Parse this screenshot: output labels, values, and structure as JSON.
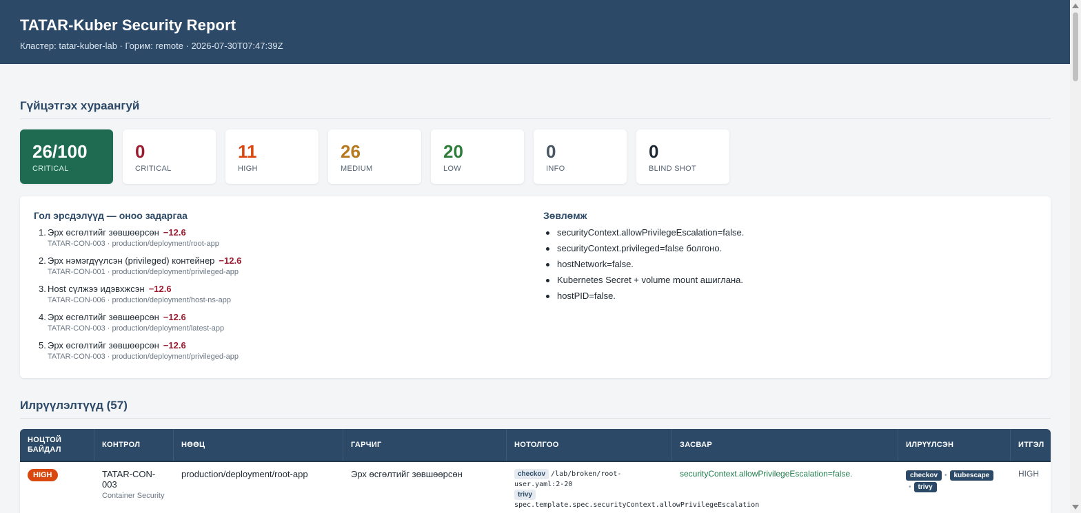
{
  "header": {
    "title": "TATAR-Kuber Security Report",
    "subtitle": "Кластер: tatar-kuber-lab · Горим: remote · 2026-07-30T07:47:39Z"
  },
  "summary": {
    "title": "Гүйцэтгэх хураангуй",
    "score": {
      "value": "26/100",
      "label": "CRITICAL"
    },
    "cards": [
      {
        "value": "0",
        "label": "CRITICAL",
        "color": "#9b1c31"
      },
      {
        "value": "11",
        "label": "HIGH",
        "color": "#d9480f"
      },
      {
        "value": "26",
        "label": "MEDIUM",
        "color": "#b7791f"
      },
      {
        "value": "20",
        "label": "LOW",
        "color": "#2f7d3a"
      },
      {
        "value": "0",
        "label": "INFO",
        "color": "#4a5563"
      },
      {
        "value": "0",
        "label": "BLIND SHOT",
        "color": "#1f2933"
      }
    ],
    "risks_title": "Гол эрсдэлүүд — оноо задаргаа",
    "risks": [
      {
        "num": "1.",
        "text": "Эрх өсгөлтийг зөвшөөрсөн",
        "penalty": "−12.6",
        "meta": "TATAR-CON-003 · production/deployment/root-app"
      },
      {
        "num": "2.",
        "text": "Эрх нэмэгдүүлсэн (privileged) контейнер",
        "penalty": "−12.6",
        "meta": "TATAR-CON-001 · production/deployment/privileged-app"
      },
      {
        "num": "3.",
        "text": "Host сүлжээ идэвхжсэн",
        "penalty": "−12.6",
        "meta": "TATAR-CON-006 · production/deployment/host-ns-app"
      },
      {
        "num": "4.",
        "text": "Эрх өсгөлтийг зөвшөөрсөн",
        "penalty": "−12.6",
        "meta": "TATAR-CON-003 · production/deployment/latest-app"
      },
      {
        "num": "5.",
        "text": "Эрх өсгөлтийг зөвшөөрсөн",
        "penalty": "−12.6",
        "meta": "TATAR-CON-003 · production/deployment/privileged-app"
      }
    ],
    "recs_title": "Зөвлөмж",
    "recs": [
      "securityContext.allowPrivilegeEscalation=false.",
      "securityContext.privileged=false болгоно.",
      "hostNetwork=false.",
      "Kubernetes Secret + volume mount ашиглана.",
      "hostPID=false."
    ]
  },
  "findings": {
    "title": "Илрүүлэлтүүд (57)",
    "columns": {
      "severity": "НОЦТОЙ БАЙДАЛ",
      "control": "КОНТРОЛ",
      "resource": "НӨӨЦ",
      "title": "ГАРЧИГ",
      "evidence": "НОТОЛГОО",
      "fix": "ЗАСВАР",
      "detected": "ИЛРҮҮЛСЭН",
      "confidence": "ИТГЭЛ"
    },
    "rows": [
      {
        "severity": "HIGH",
        "control": "TATAR-CON-003",
        "control_sub": "Container Security",
        "resource": "production/deployment/root-app",
        "title": "Эрх өсгөлтийг зөвшөөрсөн",
        "ev1_tag": "checkov",
        "ev1_text": "/lab/broken/root-user.yaml:2-20",
        "ev2_tag": "trivy",
        "ev2_text": "spec.template.spec.securityContext.allowPrivilegeEscalation",
        "fix": "securityContext.allowPrivilegeEscalation=false.",
        "detectors": [
          "checkov",
          "kubescape",
          "trivy"
        ],
        "confidence": "HIGH"
      }
    ]
  }
}
